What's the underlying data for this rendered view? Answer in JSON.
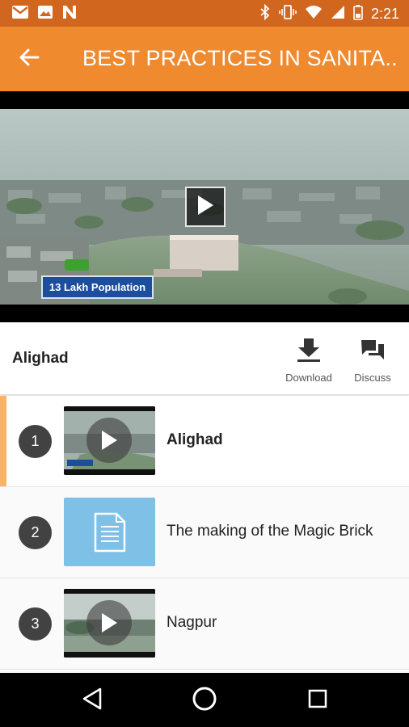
{
  "status_bar": {
    "time": "2:21",
    "left_icons": [
      "gmail-icon",
      "image-icon",
      "n-app-icon"
    ],
    "right_icons": [
      "bluetooth-icon",
      "vibrate-icon",
      "wifi-icon",
      "signal-icon",
      "battery-icon"
    ]
  },
  "app_bar": {
    "title": "BEST PRACTICES IN SANITA...",
    "back_icon": "arrow-back-icon",
    "color": "#ef8a2f"
  },
  "video": {
    "overlay_text": "13 Lakh Population",
    "play_icon": "play-icon"
  },
  "now_playing": {
    "title": "Alighad",
    "actions": [
      {
        "label": "Download",
        "icon": "download-icon"
      },
      {
        "label": "Discuss",
        "icon": "discuss-icon"
      }
    ]
  },
  "playlist": [
    {
      "number": "1",
      "title": "Alighad",
      "type": "video",
      "active": true
    },
    {
      "number": "2",
      "title": "The making of the Magic Brick",
      "type": "document",
      "active": false
    },
    {
      "number": "3",
      "title": "Nagpur",
      "type": "video",
      "active": false
    }
  ],
  "nav_bar": {
    "buttons": [
      "back-nav-icon",
      "home-nav-icon",
      "recents-nav-icon"
    ]
  }
}
